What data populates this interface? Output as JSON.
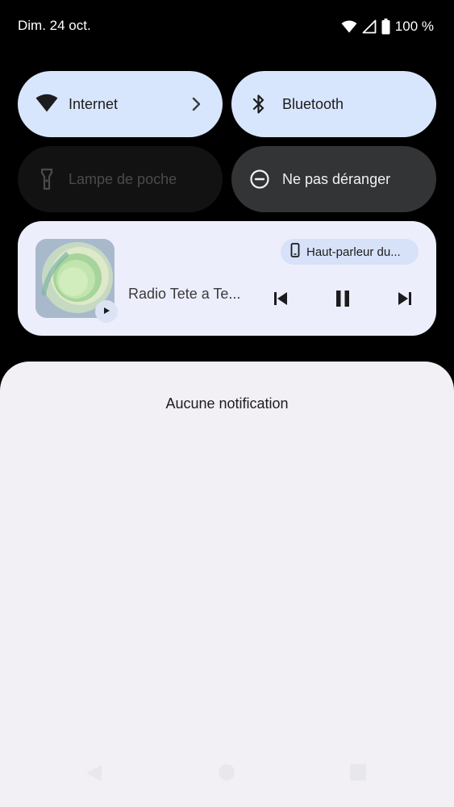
{
  "status_bar": {
    "date": "Dim. 24 oct.",
    "battery": "100 %",
    "icons": [
      "wifi-icon",
      "cell-signal-icon",
      "battery-icon"
    ]
  },
  "quick_settings": {
    "tiles": [
      {
        "label": "Internet",
        "icon": "wifi-icon",
        "state": "on"
      },
      {
        "label": "Bluetooth",
        "icon": "bluetooth-icon",
        "state": "on"
      },
      {
        "label": "Lampe de poche",
        "icon": "flashlight-icon",
        "state": "unavailable"
      },
      {
        "label": "Ne pas déranger",
        "icon": "do-not-disturb-icon",
        "state": "off"
      }
    ]
  },
  "media": {
    "title": "Radio Tete a Te...",
    "output": "Haut-parleur du...",
    "controls": [
      "previous-icon",
      "pause-icon",
      "next-icon"
    ]
  },
  "notifications": {
    "empty_text": "Aucune notification"
  },
  "navigation": {
    "buttons": [
      "back-icon",
      "home-icon",
      "recents-icon"
    ]
  },
  "colors": {
    "tile_active": "#d8e6fd",
    "tile_inactive": "#333436",
    "tile_unavailable": "#121212",
    "media_card": "#edeefc",
    "panel": "#f2f0f5"
  }
}
